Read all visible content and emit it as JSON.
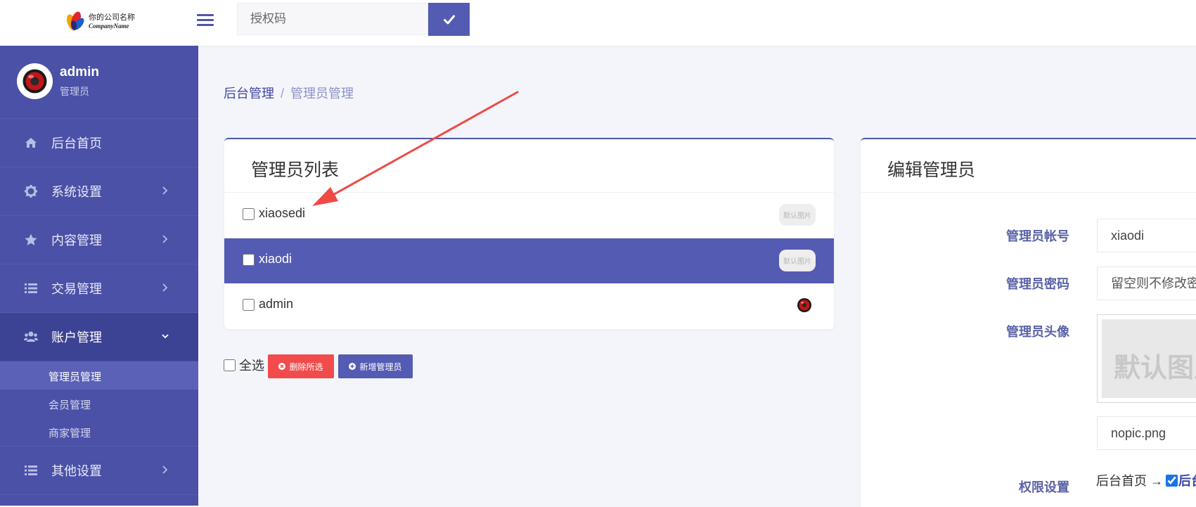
{
  "header": {
    "logo_name": "你的公司名称",
    "logo_sub": "CompanyName",
    "auth_placeholder": "授权码"
  },
  "sidebar": {
    "user_name": "admin",
    "user_role": "管理员",
    "items": [
      {
        "label": "后台首页",
        "icon": "home-icon",
        "has_arrow": false
      },
      {
        "label": "系统设置",
        "icon": "gear-icon",
        "has_arrow": true
      },
      {
        "label": "内容管理",
        "icon": "star-icon",
        "has_arrow": true
      },
      {
        "label": "交易管理",
        "icon": "list-icon",
        "has_arrow": true
      },
      {
        "label": "账户管理",
        "icon": "users-icon",
        "has_arrow": true,
        "expanded": true
      },
      {
        "label": "其他设置",
        "icon": "list-icon",
        "has_arrow": true
      }
    ],
    "subitems": [
      {
        "label": "管理员管理",
        "active": true
      },
      {
        "label": "会员管理",
        "active": false
      },
      {
        "label": "商家管理",
        "active": false
      }
    ]
  },
  "breadcrumb": {
    "root": "后台管理",
    "sep": "/",
    "current": "管理员管理"
  },
  "list_card": {
    "title": "管理员列表",
    "rows": [
      {
        "name": "xiaosedi",
        "thumb": "默认图片",
        "selected": false
      },
      {
        "name": "xiaodi",
        "thumb": "默认图片",
        "selected": true
      },
      {
        "name": "admin",
        "thumb": "avatar",
        "selected": false
      }
    ],
    "select_all": "全选",
    "delete_btn": "删除所选",
    "add_btn": "新增管理员"
  },
  "edit_card": {
    "title": "编辑管理员",
    "account_label": "管理员帐号",
    "account_value": "xiaodi",
    "password_label": "管理员密码",
    "password_placeholder": "留空则不修改密码",
    "avatar_label": "管理员头像",
    "avatar_preview": "默认图片",
    "avatar_file": "nopic.png",
    "perm_label": "权限设置",
    "perm_text": "后台首页 →",
    "perm_checked_label": "后台"
  },
  "colors": {
    "sidebar": "#4a51a6",
    "accent": "#545bb3",
    "danger": "#f14b4b"
  }
}
